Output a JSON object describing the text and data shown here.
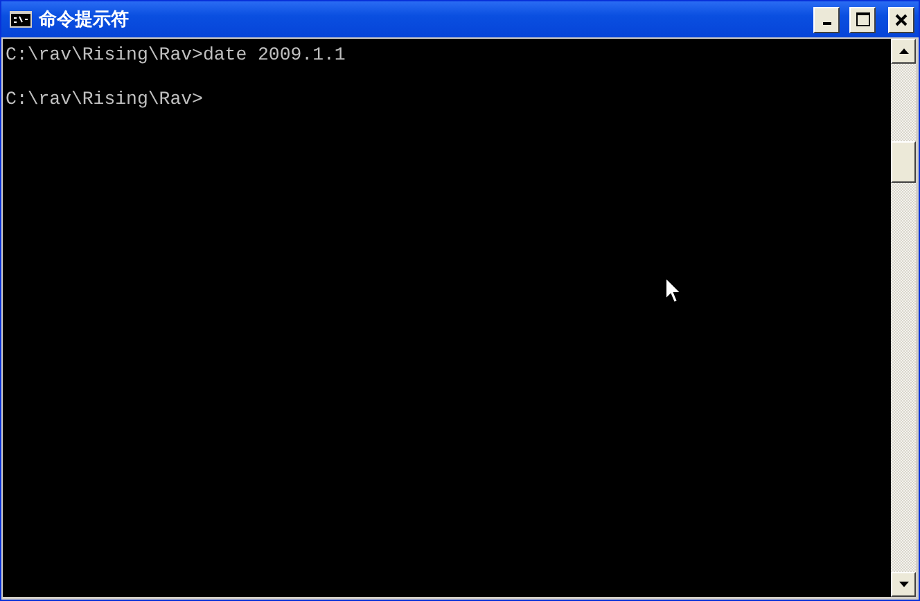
{
  "window": {
    "title": "命令提示符"
  },
  "console": {
    "lines": [
      {
        "kind": "text",
        "text": "C:\\rav\\Rising\\Rav>date 2009.1.1"
      },
      {
        "kind": "blank"
      },
      {
        "kind": "text",
        "text": "C:\\rav\\Rising\\Rav>"
      }
    ]
  }
}
